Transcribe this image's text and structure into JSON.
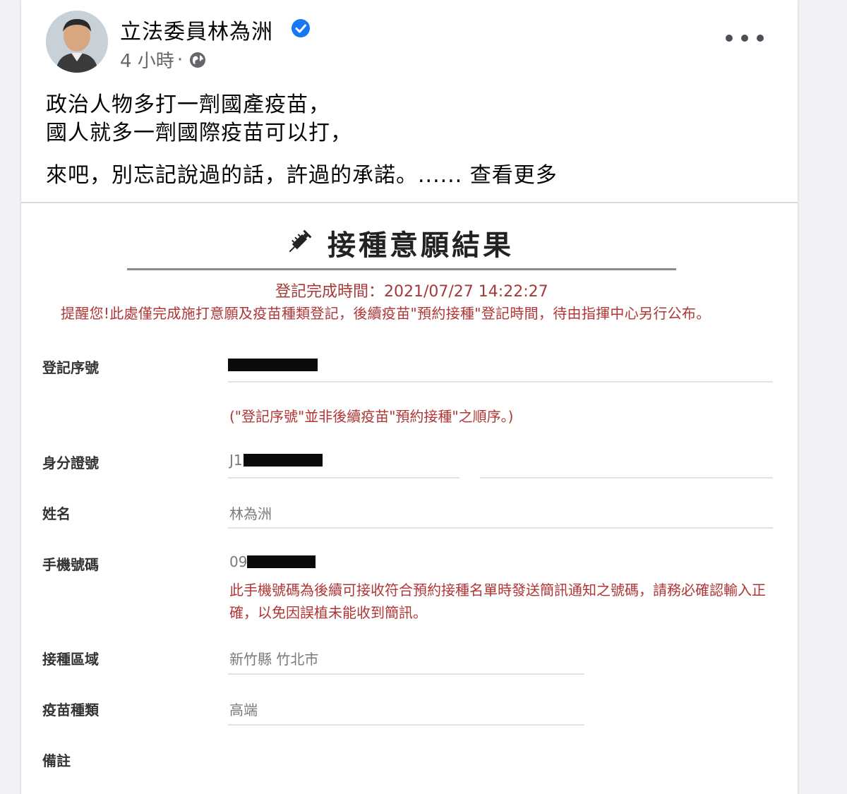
{
  "post": {
    "author": "立法委員林為洲",
    "time": "4 小時",
    "separator": "·",
    "lines": [
      "政治人物多打一劑國產疫苗，",
      "國人就多一劑國際疫苗可以打，",
      "來吧，別忘記說過的話，許過的承諾。......"
    ],
    "see_more": "查看更多",
    "icons": [
      "verified-icon",
      "globe-icon",
      "more-icon"
    ]
  },
  "result": {
    "title": "接種意願結果",
    "registration_time": "登記完成時間：2021/07/27 14:22:27",
    "reminder": "提醒您!此處僅完成施打意願及疫苗種類登記，後續疫苗\"預約接種\"登記時間，待由指揮中心另行公布。",
    "fields": {
      "serial_label": "登記序號",
      "serial_note": "(\"登記序號\"並非後續疫苗\"預約接種\"之順序。)",
      "id_label": "身分證號",
      "id_prefix": "J1",
      "name_label": "姓名",
      "name_value": "林為洲",
      "phone_label": "手機號碼",
      "phone_prefix": "09",
      "phone_note": "此手機號碼為後續可接收符合預約接種名單時發送簡訊通知之號碼，請務必確認輸入正確，以免因誤植未能收到簡訊。",
      "region_label": "接種區域",
      "region_value": "新竹縣 竹北市",
      "vaccine_label": "疫苗種類",
      "vaccine_value": "高端",
      "remarks_label": "備註"
    },
    "colors": {
      "warning_red": "#b03535",
      "verified_blue": "#1877f2"
    }
  }
}
